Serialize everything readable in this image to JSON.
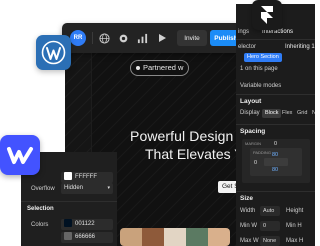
{
  "toolbar": {
    "avatar_initials": "RR",
    "invite_label": "Invite",
    "publish_label": "Publish",
    "icons": [
      "globe-icon",
      "gear-icon",
      "bar-chart-icon",
      "play-icon"
    ]
  },
  "canvas": {
    "badge_text": "Partnered w",
    "hero_line1": "Powerful Design",
    "hero_line2": "That Elevates Y",
    "cta_label": "Get St"
  },
  "style_panel": {
    "tabs": [
      "ings",
      "Interactions"
    ],
    "selector_label": "elector",
    "inheriting_label": "Inheriting 1",
    "class_chip": "Hero Section",
    "on_page_text": "1 on this page",
    "variable_modes_label": "Variable modes",
    "layout_title": "Layout",
    "display_label": "Display",
    "display_options": [
      "Block",
      "Flex",
      "Grid",
      "N"
    ],
    "spacing_title": "Spacing",
    "margin_label": "MARGIN",
    "padding_label": "PADDING",
    "spacing_values": [
      "0",
      "80",
      "0",
      "80"
    ],
    "size_title": "Size",
    "width_label": "Width",
    "width_value": "Auto",
    "height_label": "Height",
    "min_w_label": "Min W",
    "min_w_value": "0",
    "min_h_label": "Min H",
    "max_w_label": "Max W",
    "max_w_value": "None",
    "max_h_label": "Max H"
  },
  "settings_panel": {
    "color_hex": "FFFFFF",
    "overflow_label": "Overflow",
    "overflow_value": "Hidden",
    "selection_title": "Selection",
    "colors_label": "Colors",
    "swatches": [
      "001122",
      "666666"
    ]
  },
  "colors": {
    "publish_blue": "#1b8cf7",
    "class_chip_blue": "#2f7cf6",
    "webflow_blue": "#4353ff",
    "wordpress_blue": "#2b6fb5"
  }
}
